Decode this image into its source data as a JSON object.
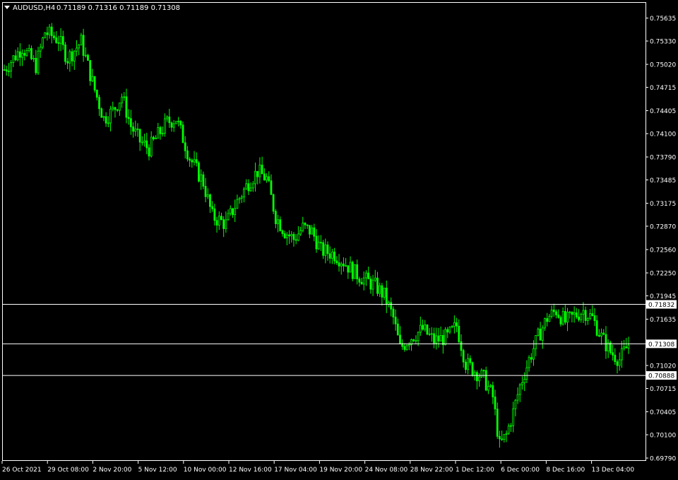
{
  "header": {
    "symbol_timeframe": "AUDUSD,H4",
    "ohlc": "0.71189 0.71316 0.71189 0.71308"
  },
  "colors": {
    "background": "#000000",
    "candle": "#00ff00",
    "frame": "#ffffff",
    "level_line": "#ffffff",
    "text": "#ffffff"
  },
  "chart_data": {
    "type": "candlestick",
    "symbol": "AUDUSD",
    "timeframe": "H4",
    "ylim": [
      0.6979,
      0.758
    ],
    "y_ticks": [
      "0.75635",
      "0.75330",
      "0.75020",
      "0.74715",
      "0.74405",
      "0.74100",
      "0.73790",
      "0.73485",
      "0.73175",
      "0.72870",
      "0.72560",
      "0.72250",
      "0.71945",
      "0.71635",
      "0.71020",
      "0.70715",
      "0.70405",
      "0.70100",
      "0.69790"
    ],
    "x_ticks": [
      "26 Oct 2021",
      "29 Oct 08:00",
      "2 Nov 20:00",
      "5 Nov 12:00",
      "10 Nov 00:00",
      "12 Nov 16:00",
      "17 Nov 04:00",
      "19 Nov 20:00",
      "24 Nov 08:00",
      "28 Nov 22:00",
      "1 Dec 12:00",
      "6 Dec 00:00",
      "8 Dec 16:00",
      "13 Dec 04:00"
    ],
    "horizontal_levels": [
      {
        "value": 0.71832,
        "label": "0.71832"
      },
      {
        "value": 0.71308,
        "label": "0.71308"
      },
      {
        "value": 0.70888,
        "label": "0.70888"
      }
    ],
    "close_path": [
      [
        0,
        0.7495
      ],
      [
        8,
        0.7525
      ],
      [
        14,
        0.75
      ],
      [
        18,
        0.7545
      ],
      [
        24,
        0.7535
      ],
      [
        28,
        0.751
      ],
      [
        34,
        0.7532
      ],
      [
        40,
        0.7468
      ],
      [
        44,
        0.743
      ],
      [
        48,
        0.744
      ],
      [
        52,
        0.746
      ],
      [
        56,
        0.742
      ],
      [
        60,
        0.74
      ],
      [
        64,
        0.739
      ],
      [
        68,
        0.7408
      ],
      [
        72,
        0.7425
      ],
      [
        76,
        0.743
      ],
      [
        82,
        0.7378
      ],
      [
        88,
        0.7345
      ],
      [
        92,
        0.73
      ],
      [
        98,
        0.729
      ],
      [
        103,
        0.732
      ],
      [
        108,
        0.7345
      ],
      [
        112,
        0.736
      ],
      [
        116,
        0.735
      ],
      [
        120,
        0.73
      ],
      [
        124,
        0.728
      ],
      [
        128,
        0.727
      ],
      [
        132,
        0.7285
      ],
      [
        136,
        0.728
      ],
      [
        140,
        0.7255
      ],
      [
        146,
        0.725
      ],
      [
        150,
        0.724
      ],
      [
        155,
        0.7225
      ],
      [
        160,
        0.7215
      ],
      [
        164,
        0.7208
      ],
      [
        168,
        0.7195
      ],
      [
        172,
        0.7165
      ],
      [
        175,
        0.7125
      ],
      [
        180,
        0.714
      ],
      [
        185,
        0.715
      ],
      [
        190,
        0.7135
      ],
      [
        196,
        0.714
      ],
      [
        200,
        0.7155
      ],
      [
        204,
        0.7105
      ],
      [
        208,
        0.7095
      ],
      [
        212,
        0.7085
      ],
      [
        216,
        0.706
      ],
      [
        219,
        0.6995
      ],
      [
        222,
        0.701
      ],
      [
        225,
        0.704
      ],
      [
        228,
        0.7075
      ],
      [
        232,
        0.711
      ],
      [
        236,
        0.714
      ],
      [
        240,
        0.7165
      ],
      [
        244,
        0.7175
      ],
      [
        248,
        0.716
      ],
      [
        252,
        0.7168
      ],
      [
        256,
        0.7175
      ],
      [
        260,
        0.7165
      ],
      [
        264,
        0.714
      ],
      [
        268,
        0.712
      ],
      [
        272,
        0.711
      ],
      [
        276,
        0.713
      ]
    ]
  }
}
